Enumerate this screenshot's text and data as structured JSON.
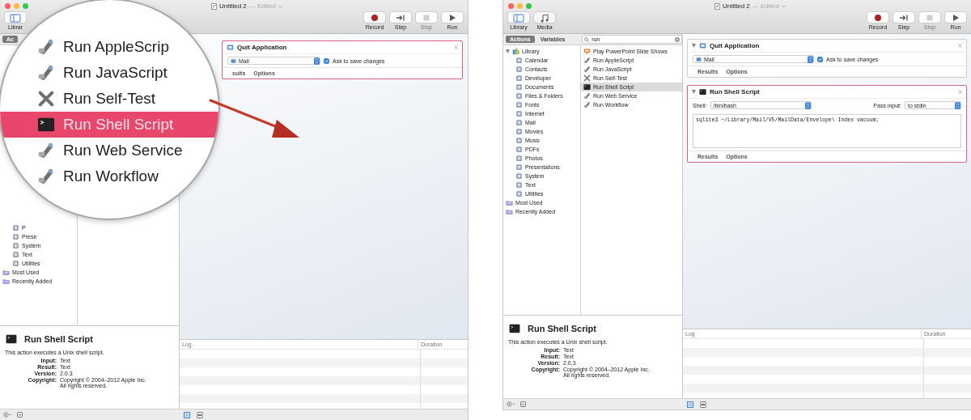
{
  "windows": [
    {
      "kind": "magnified",
      "title": "Untitled 2",
      "status": "— Edited",
      "view_buttons": [
        {
          "kind": "library",
          "label": "Librar",
          "selected": true
        }
      ],
      "controls": [
        {
          "kind": "record",
          "label": "Record",
          "disabled": false
        },
        {
          "kind": "step",
          "label": "Step",
          "disabled": false
        },
        {
          "kind": "stop",
          "label": "Stop",
          "disabled": true
        },
        {
          "kind": "run",
          "label": "Run",
          "disabled": false
        }
      ],
      "library_tabs": [
        {
          "label": "Ac",
          "selected": true
        }
      ],
      "sidebar": [
        {
          "kind": "group",
          "children": [
            {
              "kind": "category",
              "label": "P"
            },
            {
              "kind": "category",
              "label": "Prese"
            },
            {
              "kind": "category",
              "label": "System"
            },
            {
              "kind": "category",
              "label": "Text"
            },
            {
              "kind": "category",
              "label": "Utilities"
            }
          ]
        },
        {
          "kind": "folder",
          "label": "Most Used"
        },
        {
          "kind": "folder",
          "label": "Recently Added"
        }
      ],
      "workflow": [
        {
          "kind": "quit",
          "title": "Quit Application",
          "selected": true,
          "app": "Mail",
          "option": {
            "label": "Ask to save changes",
            "checked": true
          },
          "tabs": [
            "sults",
            "Options"
          ]
        }
      ],
      "info": {
        "title": "Run Shell Script",
        "description": "This action executes a Unix shell script.",
        "fields": [
          {
            "label": "Input:",
            "value": "Text"
          },
          {
            "label": "Result:",
            "value": "Text"
          },
          {
            "label": "Version:",
            "value": "2.0.3"
          },
          {
            "label": "Copyright:",
            "value": "Copyright © 2004–2012 Apple Inc.  All rights reserved."
          }
        ]
      },
      "log": {
        "columns": [
          "Log",
          "Duration"
        ]
      },
      "magnifier": {
        "items": [
          {
            "kind": "script",
            "label": "Run AppleScrip",
            "selected": false
          },
          {
            "kind": "script",
            "label": "Run JavaScript",
            "selected": false
          },
          {
            "kind": "tools",
            "label": "Run Self-Test",
            "selected": false
          },
          {
            "kind": "terminal",
            "label": "Run Shell Script",
            "selected": true
          },
          {
            "kind": "script",
            "label": "Run Web Service",
            "selected": false
          },
          {
            "kind": "script",
            "label": "Run Workflow",
            "selected": false
          }
        ]
      }
    },
    {
      "kind": "normal",
      "title": "Untitled 2",
      "status": "— Edited",
      "view_buttons": [
        {
          "kind": "library",
          "label": "Library",
          "selected": true
        },
        {
          "kind": "media",
          "label": "Media",
          "selected": false
        }
      ],
      "controls": [
        {
          "kind": "record",
          "label": "Record",
          "disabled": false
        },
        {
          "kind": "step",
          "label": "Step",
          "disabled": false
        },
        {
          "kind": "stop",
          "label": "Stop",
          "disabled": true
        },
        {
          "kind": "run",
          "label": "Run",
          "disabled": false
        }
      ],
      "library_tabs": [
        {
          "label": "Actions",
          "selected": true
        },
        {
          "label": "Variables",
          "selected": false
        }
      ],
      "search": {
        "value": "run"
      },
      "sidebar": [
        {
          "kind": "group",
          "label": "Library",
          "expanded": true,
          "children": [
            {
              "kind": "category",
              "label": "Calendar"
            },
            {
              "kind": "category",
              "label": "Contacts"
            },
            {
              "kind": "category",
              "label": "Developer"
            },
            {
              "kind": "category",
              "label": "Documents"
            },
            {
              "kind": "category",
              "label": "Files & Folders"
            },
            {
              "kind": "category",
              "label": "Fonts"
            },
            {
              "kind": "category",
              "label": "Internet"
            },
            {
              "kind": "category",
              "label": "Mail"
            },
            {
              "kind": "category",
              "label": "Movies"
            },
            {
              "kind": "category",
              "label": "Music"
            },
            {
              "kind": "category",
              "label": "PDFs"
            },
            {
              "kind": "category",
              "label": "Photos"
            },
            {
              "kind": "category",
              "label": "Presentations"
            },
            {
              "kind": "category",
              "label": "System"
            },
            {
              "kind": "category",
              "label": "Text"
            },
            {
              "kind": "category",
              "label": "Utilities"
            }
          ]
        },
        {
          "kind": "folder",
          "label": "Most Used"
        },
        {
          "kind": "folder",
          "label": "Recently Added"
        }
      ],
      "actions": [
        {
          "kind": "slides",
          "label": "Play PowerPoint Slide Shows",
          "selected": false
        },
        {
          "kind": "script",
          "label": "Run AppleScript",
          "selected": false
        },
        {
          "kind": "script",
          "label": "Run JavaScript",
          "selected": false
        },
        {
          "kind": "tools",
          "label": "Run Self-Test",
          "selected": false
        },
        {
          "kind": "terminal",
          "label": "Run Shell Script",
          "selected": true
        },
        {
          "kind": "script",
          "label": "Run Web Service",
          "selected": false
        },
        {
          "kind": "script",
          "label": "Run Workflow",
          "selected": false
        }
      ],
      "workflow": [
        {
          "kind": "quit",
          "title": "Quit Application",
          "selected": false,
          "expanded": true,
          "app": "Mail",
          "option": {
            "label": "Ask to save changes",
            "checked": true
          },
          "tabs": [
            "Results",
            "Options"
          ]
        },
        {
          "kind": "shell",
          "title": "Run Shell Script",
          "selected": true,
          "expanded": true,
          "shell_label": "Shell:",
          "shell": "/bin/bash",
          "input_label": "Pass input:",
          "input": "to stdin",
          "script": "sqlite3 ~/Library/Mail/V5/MailData/Envelope\\ Index vacuum;",
          "tabs": [
            "Results",
            "Options"
          ]
        }
      ],
      "info": {
        "title": "Run Shell Script",
        "description": "This action executes a Unix shell script.",
        "fields": [
          {
            "label": "Input:",
            "value": "Text"
          },
          {
            "label": "Result:",
            "value": "Text"
          },
          {
            "label": "Version:",
            "value": "2.0.3"
          },
          {
            "label": "Copyright:",
            "value": "Copyright © 2004–2012 Apple Inc.  All rights reserved."
          }
        ]
      },
      "log": {
        "columns": [
          "Log",
          "Duration"
        ]
      }
    }
  ]
}
